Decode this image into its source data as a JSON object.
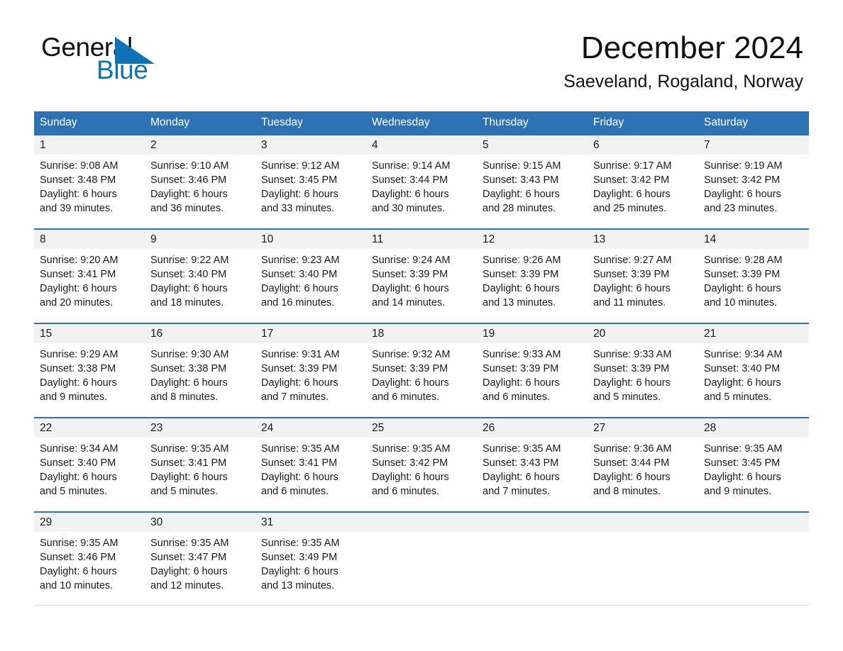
{
  "brand": {
    "name_part1": "General",
    "name_part2": "Blue",
    "triangle_color": "#0f72b5",
    "text_color": "#111111"
  },
  "header": {
    "month_title": "December 2024",
    "location": "Saeveland, Rogaland, Norway"
  },
  "colors": {
    "header_blue": "#2c72b5",
    "day_band_gray": "#f2f2f2",
    "text": "#1a1a1a",
    "accent_blue": "#0f72b5"
  },
  "weekdays": [
    "Sunday",
    "Monday",
    "Tuesday",
    "Wednesday",
    "Thursday",
    "Friday",
    "Saturday"
  ],
  "weeks": [
    {
      "days": [
        {
          "num": "1",
          "sunrise": "Sunrise: 9:08 AM",
          "sunset": "Sunset: 3:48 PM",
          "daylight1": "Daylight: 6 hours",
          "daylight2": "and 39 minutes."
        },
        {
          "num": "2",
          "sunrise": "Sunrise: 9:10 AM",
          "sunset": "Sunset: 3:46 PM",
          "daylight1": "Daylight: 6 hours",
          "daylight2": "and 36 minutes."
        },
        {
          "num": "3",
          "sunrise": "Sunrise: 9:12 AM",
          "sunset": "Sunset: 3:45 PM",
          "daylight1": "Daylight: 6 hours",
          "daylight2": "and 33 minutes."
        },
        {
          "num": "4",
          "sunrise": "Sunrise: 9:14 AM",
          "sunset": "Sunset: 3:44 PM",
          "daylight1": "Daylight: 6 hours",
          "daylight2": "and 30 minutes."
        },
        {
          "num": "5",
          "sunrise": "Sunrise: 9:15 AM",
          "sunset": "Sunset: 3:43 PM",
          "daylight1": "Daylight: 6 hours",
          "daylight2": "and 28 minutes."
        },
        {
          "num": "6",
          "sunrise": "Sunrise: 9:17 AM",
          "sunset": "Sunset: 3:42 PM",
          "daylight1": "Daylight: 6 hours",
          "daylight2": "and 25 minutes."
        },
        {
          "num": "7",
          "sunrise": "Sunrise: 9:19 AM",
          "sunset": "Sunset: 3:42 PM",
          "daylight1": "Daylight: 6 hours",
          "daylight2": "and 23 minutes."
        }
      ]
    },
    {
      "days": [
        {
          "num": "8",
          "sunrise": "Sunrise: 9:20 AM",
          "sunset": "Sunset: 3:41 PM",
          "daylight1": "Daylight: 6 hours",
          "daylight2": "and 20 minutes."
        },
        {
          "num": "9",
          "sunrise": "Sunrise: 9:22 AM",
          "sunset": "Sunset: 3:40 PM",
          "daylight1": "Daylight: 6 hours",
          "daylight2": "and 18 minutes."
        },
        {
          "num": "10",
          "sunrise": "Sunrise: 9:23 AM",
          "sunset": "Sunset: 3:40 PM",
          "daylight1": "Daylight: 6 hours",
          "daylight2": "and 16 minutes."
        },
        {
          "num": "11",
          "sunrise": "Sunrise: 9:24 AM",
          "sunset": "Sunset: 3:39 PM",
          "daylight1": "Daylight: 6 hours",
          "daylight2": "and 14 minutes."
        },
        {
          "num": "12",
          "sunrise": "Sunrise: 9:26 AM",
          "sunset": "Sunset: 3:39 PM",
          "daylight1": "Daylight: 6 hours",
          "daylight2": "and 13 minutes."
        },
        {
          "num": "13",
          "sunrise": "Sunrise: 9:27 AM",
          "sunset": "Sunset: 3:39 PM",
          "daylight1": "Daylight: 6 hours",
          "daylight2": "and 11 minutes."
        },
        {
          "num": "14",
          "sunrise": "Sunrise: 9:28 AM",
          "sunset": "Sunset: 3:39 PM",
          "daylight1": "Daylight: 6 hours",
          "daylight2": "and 10 minutes."
        }
      ]
    },
    {
      "days": [
        {
          "num": "15",
          "sunrise": "Sunrise: 9:29 AM",
          "sunset": "Sunset: 3:38 PM",
          "daylight1": "Daylight: 6 hours",
          "daylight2": "and 9 minutes."
        },
        {
          "num": "16",
          "sunrise": "Sunrise: 9:30 AM",
          "sunset": "Sunset: 3:38 PM",
          "daylight1": "Daylight: 6 hours",
          "daylight2": "and 8 minutes."
        },
        {
          "num": "17",
          "sunrise": "Sunrise: 9:31 AM",
          "sunset": "Sunset: 3:39 PM",
          "daylight1": "Daylight: 6 hours",
          "daylight2": "and 7 minutes."
        },
        {
          "num": "18",
          "sunrise": "Sunrise: 9:32 AM",
          "sunset": "Sunset: 3:39 PM",
          "daylight1": "Daylight: 6 hours",
          "daylight2": "and 6 minutes."
        },
        {
          "num": "19",
          "sunrise": "Sunrise: 9:33 AM",
          "sunset": "Sunset: 3:39 PM",
          "daylight1": "Daylight: 6 hours",
          "daylight2": "and 6 minutes."
        },
        {
          "num": "20",
          "sunrise": "Sunrise: 9:33 AM",
          "sunset": "Sunset: 3:39 PM",
          "daylight1": "Daylight: 6 hours",
          "daylight2": "and 5 minutes."
        },
        {
          "num": "21",
          "sunrise": "Sunrise: 9:34 AM",
          "sunset": "Sunset: 3:40 PM",
          "daylight1": "Daylight: 6 hours",
          "daylight2": "and 5 minutes."
        }
      ]
    },
    {
      "days": [
        {
          "num": "22",
          "sunrise": "Sunrise: 9:34 AM",
          "sunset": "Sunset: 3:40 PM",
          "daylight1": "Daylight: 6 hours",
          "daylight2": "and 5 minutes."
        },
        {
          "num": "23",
          "sunrise": "Sunrise: 9:35 AM",
          "sunset": "Sunset: 3:41 PM",
          "daylight1": "Daylight: 6 hours",
          "daylight2": "and 5 minutes."
        },
        {
          "num": "24",
          "sunrise": "Sunrise: 9:35 AM",
          "sunset": "Sunset: 3:41 PM",
          "daylight1": "Daylight: 6 hours",
          "daylight2": "and 6 minutes."
        },
        {
          "num": "25",
          "sunrise": "Sunrise: 9:35 AM",
          "sunset": "Sunset: 3:42 PM",
          "daylight1": "Daylight: 6 hours",
          "daylight2": "and 6 minutes."
        },
        {
          "num": "26",
          "sunrise": "Sunrise: 9:35 AM",
          "sunset": "Sunset: 3:43 PM",
          "daylight1": "Daylight: 6 hours",
          "daylight2": "and 7 minutes."
        },
        {
          "num": "27",
          "sunrise": "Sunrise: 9:36 AM",
          "sunset": "Sunset: 3:44 PM",
          "daylight1": "Daylight: 6 hours",
          "daylight2": "and 8 minutes."
        },
        {
          "num": "28",
          "sunrise": "Sunrise: 9:35 AM",
          "sunset": "Sunset: 3:45 PM",
          "daylight1": "Daylight: 6 hours",
          "daylight2": "and 9 minutes."
        }
      ]
    },
    {
      "days": [
        {
          "num": "29",
          "sunrise": "Sunrise: 9:35 AM",
          "sunset": "Sunset: 3:46 PM",
          "daylight1": "Daylight: 6 hours",
          "daylight2": "and 10 minutes."
        },
        {
          "num": "30",
          "sunrise": "Sunrise: 9:35 AM",
          "sunset": "Sunset: 3:47 PM",
          "daylight1": "Daylight: 6 hours",
          "daylight2": "and 12 minutes."
        },
        {
          "num": "31",
          "sunrise": "Sunrise: 9:35 AM",
          "sunset": "Sunset: 3:49 PM",
          "daylight1": "Daylight: 6 hours",
          "daylight2": "and 13 minutes."
        },
        {
          "num": "",
          "sunrise": "",
          "sunset": "",
          "daylight1": "",
          "daylight2": ""
        },
        {
          "num": "",
          "sunrise": "",
          "sunset": "",
          "daylight1": "",
          "daylight2": ""
        },
        {
          "num": "",
          "sunrise": "",
          "sunset": "",
          "daylight1": "",
          "daylight2": ""
        },
        {
          "num": "",
          "sunrise": "",
          "sunset": "",
          "daylight1": "",
          "daylight2": ""
        }
      ]
    }
  ]
}
